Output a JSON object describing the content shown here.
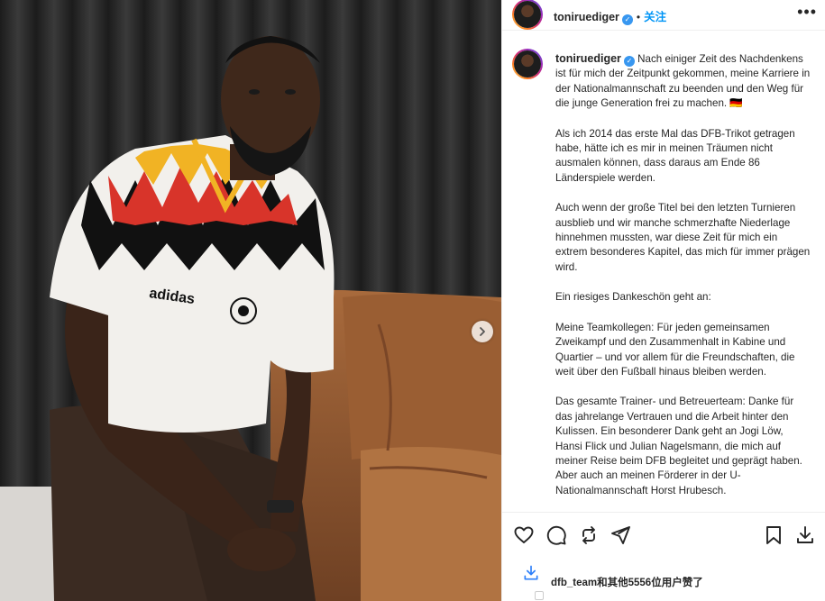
{
  "post": {
    "username": "toniruediger",
    "follow_label": "关注",
    "more_label": "•••",
    "caption_paragraphs": [
      "Als ich 2014 das erste Mal das DFB-Trikot getragen habe, hätte ich es mir in meinen Träumen nicht ausmalen können, dass daraus am Ende 86 Länderspiele werden.",
      "Auch wenn der große Titel bei den letzten Turnieren ausblieb und wir manche schmerzhafte Niederlage hinnehmen mussten, war diese Zeit für mich ein extrem besonderes Kapitel, das mich für immer prägen wird.",
      "Ein riesiges Dankeschön geht an:",
      "Meine Teamkollegen: Für jeden gemeinsamen Zweikampf und den Zusammenhalt in Kabine und Quartier – und vor allem für die Freundschaften, die weit über den Fußball hinaus bleiben werden.",
      "Das gesamte Trainer- und Betreuerteam: Danke für das jahrelange Vertrauen und die Arbeit hinter den Kulissen. Ein besonderer Dank geht an Jogi Löw, Hansi Flick und Julian Nagelsmann, die mich auf meiner Reise beim DFB begleitet und geprägt haben. Aber auch an meinen Förderer in der U-Nationalmannschaft Horst Hrubesch."
    ],
    "caption_first": "Nach einiger Zeit des Nachdenkens ist für mich der Zeitpunkt gekommen, meine Karriere in der Nationalmannschaft zu beenden und den Weg für die junge Generation frei zu machen. 🇩🇪",
    "likes_text": "dfb_team和其他5556位用户赞了"
  },
  "colors": {
    "accent": "#0095f6",
    "verified": "#3897f0",
    "text": "#262626"
  },
  "icons": [
    "verified-badge-icon",
    "more-options-icon",
    "next-image-icon",
    "like-heart-icon",
    "comment-icon",
    "repost-icon",
    "share-icon",
    "save-bookmark-icon",
    "download-icon"
  ]
}
